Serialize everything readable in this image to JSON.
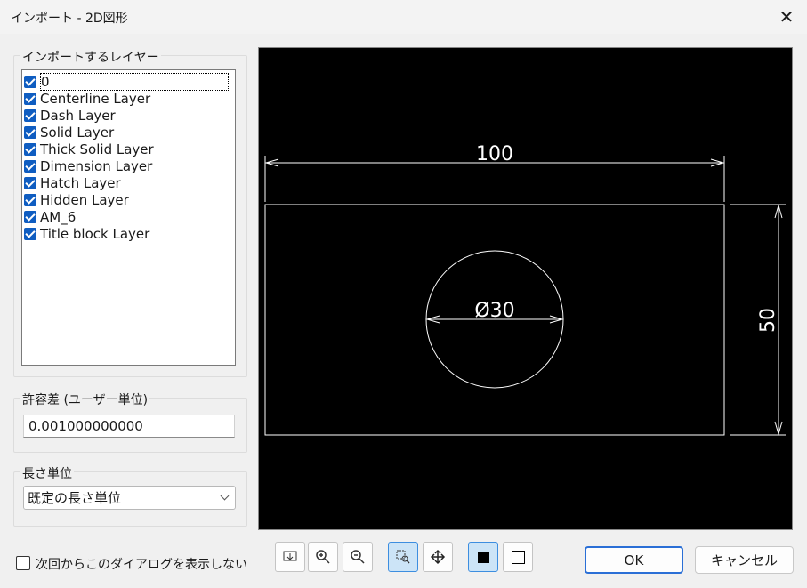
{
  "window": {
    "title": "インポート - 2D図形",
    "close_glyph": "✕"
  },
  "layers": {
    "group_label": "インポートするレイヤー",
    "items": [
      {
        "label": "0",
        "checked": true
      },
      {
        "label": "Centerline Layer",
        "checked": true
      },
      {
        "label": "Dash Layer",
        "checked": true
      },
      {
        "label": "Solid Layer",
        "checked": true
      },
      {
        "label": "Thick Solid Layer",
        "checked": true
      },
      {
        "label": "Dimension Layer",
        "checked": true
      },
      {
        "label": "Hatch Layer",
        "checked": true
      },
      {
        "label": "Hidden Layer",
        "checked": true
      },
      {
        "label": "AM_6",
        "checked": true
      },
      {
        "label": "Title block Layer",
        "checked": true
      }
    ]
  },
  "tolerance": {
    "group_label": "許容差 (ユーザー単位)",
    "value": "0.001000000000"
  },
  "units": {
    "group_label": "長さ単位",
    "selected": "既定の長さ単位"
  },
  "preview": {
    "dim_width": "100",
    "dim_diameter": "Ø30",
    "dim_height": "50"
  },
  "toolbar": {
    "buttons": [
      {
        "name": "zoom-extents-icon",
        "active": false
      },
      {
        "name": "zoom-in-icon",
        "active": false
      },
      {
        "name": "zoom-out-icon",
        "active": false
      },
      {
        "name": "zoom-window-icon",
        "active": true
      },
      {
        "name": "pan-icon",
        "active": false
      },
      {
        "name": "black-background-icon",
        "active": true
      },
      {
        "name": "white-background-icon",
        "active": false
      }
    ]
  },
  "footer": {
    "dont_show_label": "次回からこのダイアログを表示しない",
    "dont_show_checked": false,
    "ok_label": "OK",
    "cancel_label": "キャンセル"
  },
  "colors": {
    "accent": "#0f5dc1",
    "preview_bg": "#000000",
    "drawing_line": "#ffffff"
  }
}
